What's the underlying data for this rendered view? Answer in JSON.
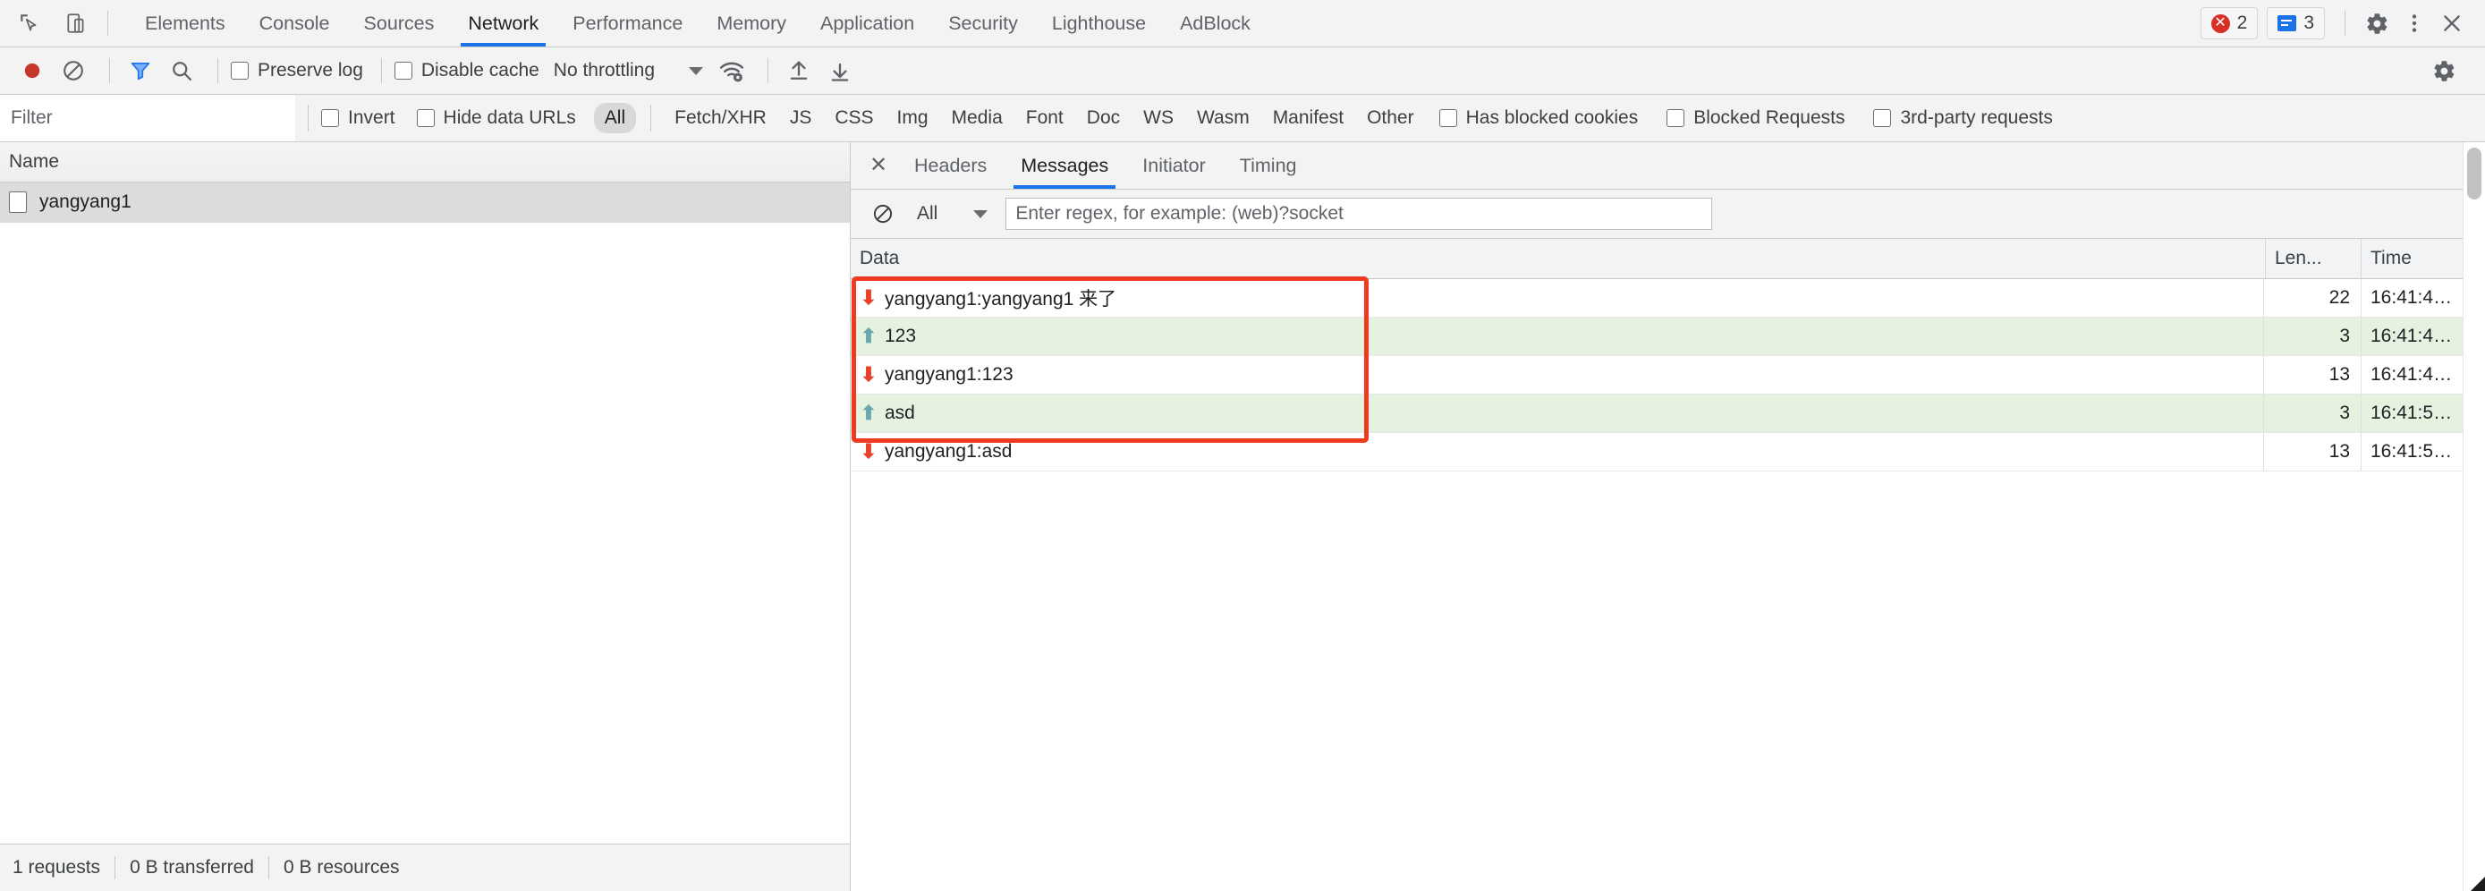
{
  "top_bar": {
    "icons": [
      {
        "name": "inspect-element-icon",
        "glyph": "inspect"
      },
      {
        "name": "device-toolbar-icon",
        "glyph": "device"
      }
    ],
    "tabs": [
      {
        "label": "Elements",
        "active": false
      },
      {
        "label": "Console",
        "active": false
      },
      {
        "label": "Sources",
        "active": false
      },
      {
        "label": "Network",
        "active": true
      },
      {
        "label": "Performance",
        "active": false
      },
      {
        "label": "Memory",
        "active": false
      },
      {
        "label": "Application",
        "active": false
      },
      {
        "label": "Security",
        "active": false
      },
      {
        "label": "Lighthouse",
        "active": false
      },
      {
        "label": "AdBlock",
        "active": false
      }
    ],
    "error_count": "2",
    "message_count": "3",
    "settings_icon": "gear-icon",
    "more_icon": "three-dot-menu-icon",
    "close_icon": "close-icon"
  },
  "network_toolbar": {
    "record_label": "record-button",
    "clear_label": "clear-button",
    "filter_label": "filter-toggle",
    "search_label": "search-button",
    "preserve_log": "Preserve log",
    "disable_cache": "Disable cache",
    "throttling": "No throttling",
    "wifi_icon": "network-conditions-icon",
    "import_icon": "import-har-icon",
    "export_icon": "export-har-icon",
    "settings_icon": "network-settings-gear-icon"
  },
  "filter_row": {
    "filter_placeholder": "Filter",
    "filter_value": "",
    "invert": "Invert",
    "hide_data_urls": "Hide data URLs",
    "types": [
      {
        "label": "All",
        "selected": true
      },
      {
        "label": "Fetch/XHR",
        "selected": false
      },
      {
        "label": "JS",
        "selected": false
      },
      {
        "label": "CSS",
        "selected": false
      },
      {
        "label": "Img",
        "selected": false
      },
      {
        "label": "Media",
        "selected": false
      },
      {
        "label": "Font",
        "selected": false
      },
      {
        "label": "Doc",
        "selected": false
      },
      {
        "label": "WS",
        "selected": false
      },
      {
        "label": "Wasm",
        "selected": false
      },
      {
        "label": "Manifest",
        "selected": false
      },
      {
        "label": "Other",
        "selected": false
      }
    ],
    "has_blocked_cookies": "Has blocked cookies",
    "blocked_requests": "Blocked Requests",
    "third_party_requests": "3rd-party requests"
  },
  "left_pane": {
    "column_header": "Name",
    "requests": [
      {
        "name": "yangyang1",
        "selected": true
      }
    ],
    "status": {
      "requests": "1 requests",
      "transferred": "0 B transferred",
      "resources": "0 B resources"
    }
  },
  "right_pane": {
    "close_icon": "close-panel-icon",
    "tabs": [
      {
        "label": "Headers",
        "active": false
      },
      {
        "label": "Messages",
        "active": true
      },
      {
        "label": "Initiator",
        "active": false
      },
      {
        "label": "Timing",
        "active": false
      }
    ],
    "message_filter": {
      "clear_icon": "clear-messages-icon",
      "type_filter": "All",
      "regex_placeholder": "Enter regex, for example: (web)?socket",
      "regex_value": ""
    },
    "table": {
      "headers": {
        "data": "Data",
        "length": "Len...",
        "time": "Time"
      },
      "rows": [
        {
          "direction": "received",
          "arrow": "⬇",
          "data": "yangyang1:yangyang1 来了",
          "length": "22",
          "time": "16:41:4…"
        },
        {
          "direction": "sent",
          "arrow": "⬆",
          "data": "123",
          "length": "3",
          "time": "16:41:4…"
        },
        {
          "direction": "received",
          "arrow": "⬇",
          "data": "yangyang1:123",
          "length": "13",
          "time": "16:41:4…"
        },
        {
          "direction": "sent",
          "arrow": "⬆",
          "data": "asd",
          "length": "3",
          "time": "16:41:5…"
        },
        {
          "direction": "received",
          "arrow": "⬇",
          "data": "yangyang1:asd",
          "length": "13",
          "time": "16:41:5…"
        }
      ]
    }
  },
  "annotation": {
    "type": "red-rectangle-highlight",
    "color": "#ef3a1f"
  }
}
